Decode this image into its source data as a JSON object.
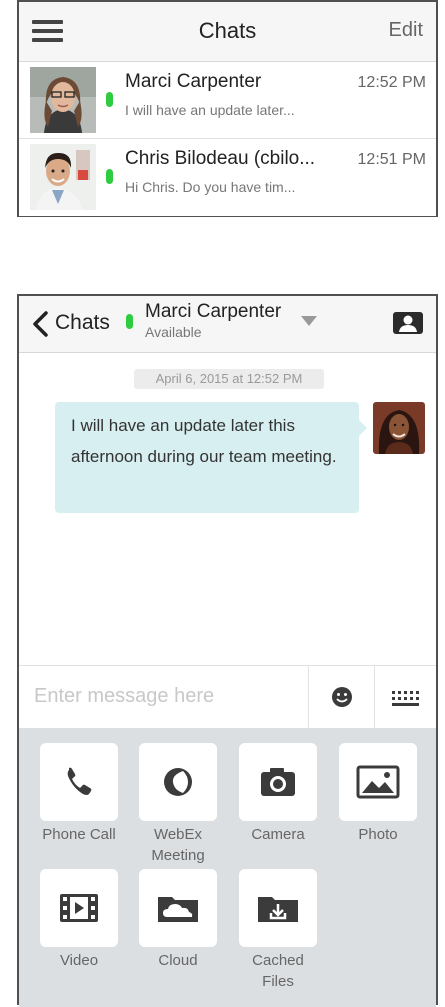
{
  "chat_list": {
    "title": "Chats",
    "edit_label": "Edit",
    "chats": [
      {
        "name": "Marci Carpenter",
        "preview": "I will have an update later...",
        "time": "12:52 PM"
      },
      {
        "name": "Chris Bilodeau (cbilo...",
        "preview": "Hi Chris. Do you have tim...",
        "time": "12:51 PM"
      }
    ]
  },
  "conversation": {
    "back_label": "Chats",
    "contact_name": "Marci Carpenter",
    "presence": "Available",
    "date_stamp": "April 6, 2015 at 12:52 PM",
    "message": "I will have an update later this afternoon during our team meeting.",
    "compose_placeholder": "Enter message here"
  },
  "actions": [
    {
      "icon": "phone-icon",
      "label": "Phone Call"
    },
    {
      "icon": "webex-icon",
      "label": "WebEx\nMeeting"
    },
    {
      "icon": "camera-icon",
      "label": "Camera"
    },
    {
      "icon": "photo-icon",
      "label": "Photo"
    },
    {
      "icon": "video-icon",
      "label": "Video"
    },
    {
      "icon": "cloud-icon",
      "label": "Cloud"
    },
    {
      "icon": "cached-files-icon",
      "label": "Cached\nFiles"
    }
  ],
  "colors": {
    "presence_green": "#2ecc40",
    "bubble": "#d7eff0",
    "tray": "#dcdfe2",
    "icon_dark": "#3b3b3b"
  }
}
